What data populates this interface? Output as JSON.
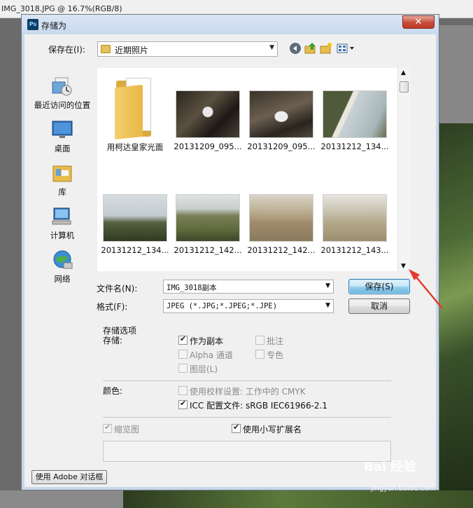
{
  "background": {
    "ps_title": "IMG_3018.JPG @ 16.7%(RGB/8)"
  },
  "dialog": {
    "title": "存储为",
    "close_label": "✕"
  },
  "save_in": {
    "label": "保存在(I):",
    "folder": "近期照片"
  },
  "places": [
    {
      "label": "最近访问的位置",
      "icon": "recent-places-icon"
    },
    {
      "label": "桌面",
      "icon": "desktop-icon"
    },
    {
      "label": "库",
      "icon": "libraries-icon"
    },
    {
      "label": "计算机",
      "icon": "computer-icon"
    },
    {
      "label": "网络",
      "icon": "network-icon"
    }
  ],
  "files": [
    {
      "name": "用柯达皇家光面",
      "kind": "folder"
    },
    {
      "name": "20131209_095...",
      "kind": "photo"
    },
    {
      "name": "20131209_095...",
      "kind": "photo"
    },
    {
      "name": "20131212_134...",
      "kind": "photo"
    },
    {
      "name": "20131212_134...",
      "kind": "photo"
    },
    {
      "name": "20131212_142...",
      "kind": "photo"
    },
    {
      "name": "20131212_142...",
      "kind": "photo"
    },
    {
      "name": "20131212_143...",
      "kind": "photo"
    }
  ],
  "filename": {
    "label": "文件名(N):",
    "value": "IMG_3018副本"
  },
  "format": {
    "label": "格式(F):",
    "value": "JPEG (*.JPG;*.JPEG;*.JPE)"
  },
  "buttons": {
    "save": "保存(S)",
    "cancel": "取消",
    "adobe_dialog": "使用 Adobe 对话框"
  },
  "options": {
    "group_title": "存储选项",
    "save_label": "存储:",
    "as_copy": "作为副本",
    "notes": "批注",
    "alpha": "Alpha 通道",
    "spot": "专色",
    "layers": "图层(L)",
    "color_label": "颜色:",
    "proof": "使用校样设置: 工作中的 CMYK",
    "icc": "ICC 配置文件: sRGB IEC61966-2.1",
    "thumbnail": "缩览图",
    "lowercase_ext": "使用小写扩展名"
  },
  "watermark": {
    "logo": "Bai 经验",
    "url": "jingyan.baidu.com"
  }
}
